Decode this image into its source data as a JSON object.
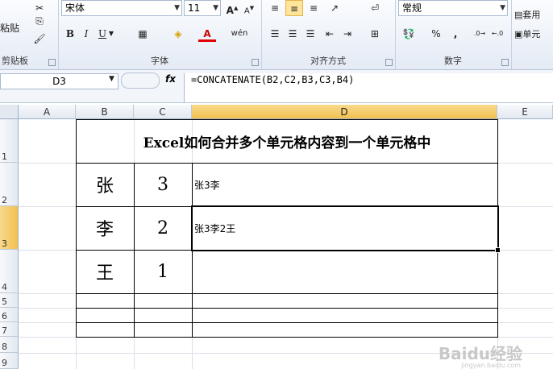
{
  "ribbon": {
    "clipboard": {
      "paste_label": "粘贴",
      "group_label": "剪贴板"
    },
    "font": {
      "font_name": "宋体",
      "font_size": "11",
      "group_label": "字体",
      "bold": "B",
      "italic": "I",
      "underline": "U",
      "color_a": "A",
      "wen": "wén"
    },
    "alignment": {
      "group_label": "对齐方式"
    },
    "number": {
      "format": "常规",
      "group_label": "数字",
      "percent": "%",
      "comma": ","
    },
    "styles": {
      "apply_label": "套用",
      "cell_label": "单元"
    }
  },
  "formula_bar": {
    "name_box": "D3",
    "fx": "fx",
    "formula": "=CONCATENATE(B2,C2,B3,C3,B4)"
  },
  "columns": [
    "A",
    "B",
    "C",
    "D",
    "E"
  ],
  "rows": [
    "1",
    "2",
    "3",
    "4",
    "5",
    "6",
    "7",
    "8",
    "9"
  ],
  "cells": {
    "title": "Excel如何合并多个单元格内容到一个单元格中",
    "b2": "张",
    "c2": "3",
    "d2": "张3李",
    "b3": "李",
    "c3": "2",
    "d3": "张3李2王",
    "b4": "王",
    "c4": "1"
  },
  "watermark": {
    "main": "Baidu经验",
    "sub": "jingyan.baidu.com"
  }
}
